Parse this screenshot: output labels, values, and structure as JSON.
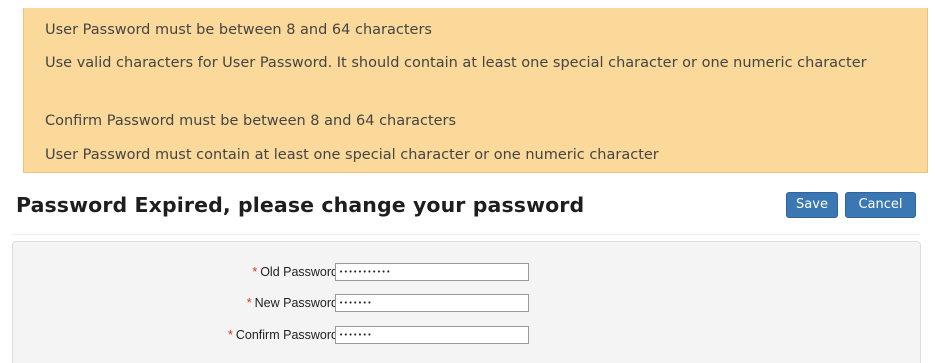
{
  "errors": [
    "User Password must be between 8 and 64 characters",
    "Use valid characters for User Password. It should contain at least one special character or one numeric character",
    "Confirm Password must be between 8 and 64 characters",
    "User Password must contain at least one special character or one numeric character"
  ],
  "header": {
    "title": "Password Expired, please change your password",
    "save_label": "Save",
    "cancel_label": "Cancel"
  },
  "form": {
    "required_marker": "*",
    "fields": [
      {
        "label": "Old Password",
        "value": "•••••••••••"
      },
      {
        "label": "New Password",
        "value": "•••••••"
      },
      {
        "label": "Confirm Password",
        "value": "•••••••"
      }
    ]
  },
  "colors": {
    "error_background": "#fbd99a",
    "button": "#3b78b3",
    "required": "#d9302b"
  }
}
